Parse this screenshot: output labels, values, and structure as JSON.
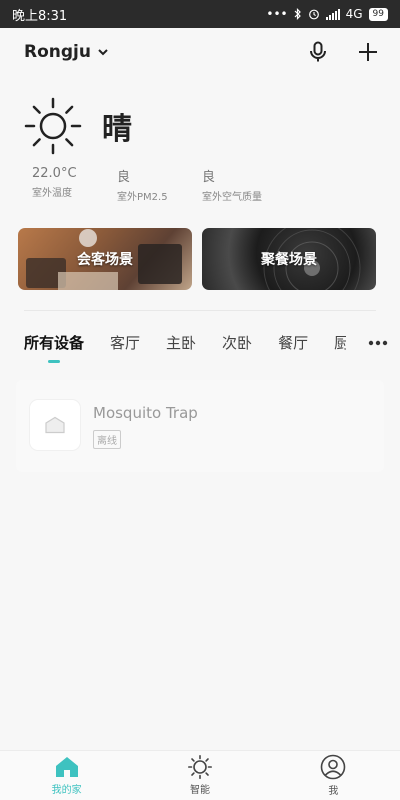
{
  "status_bar": {
    "time": "晚上8:31",
    "dots": "•••",
    "network": "4G",
    "battery": "99"
  },
  "header": {
    "home_name": "Rongju",
    "icons": [
      "chevron-down-icon",
      "microphone-icon",
      "plus-icon"
    ]
  },
  "weather": {
    "icon": "sun-icon",
    "condition": "晴",
    "stats": [
      {
        "value": "22.0°C",
        "label": "室外温度"
      },
      {
        "value": "良",
        "label": "室外PM2.5"
      },
      {
        "value": "良",
        "label": "室外空气质量"
      }
    ]
  },
  "scenes": [
    {
      "label": "会客场景"
    },
    {
      "label": "聚餐场景"
    }
  ],
  "tabs": [
    {
      "label": "所有设备",
      "active": true
    },
    {
      "label": "客厅"
    },
    {
      "label": "主卧"
    },
    {
      "label": "次卧"
    },
    {
      "label": "餐厅"
    },
    {
      "label": "厨"
    }
  ],
  "devices": [
    {
      "name": "Mosquito Trap",
      "status": "离线",
      "icon": "house-icon"
    }
  ],
  "bottom_nav": [
    {
      "label": "我的家",
      "icon": "home-icon",
      "active": true
    },
    {
      "label": "智能",
      "icon": "sun-icon"
    },
    {
      "label": "我",
      "icon": "user-icon"
    }
  ],
  "colors": {
    "accent": "#3ec2c0",
    "status_bar": "#2b2b2b",
    "background": "#f7f7f7"
  }
}
